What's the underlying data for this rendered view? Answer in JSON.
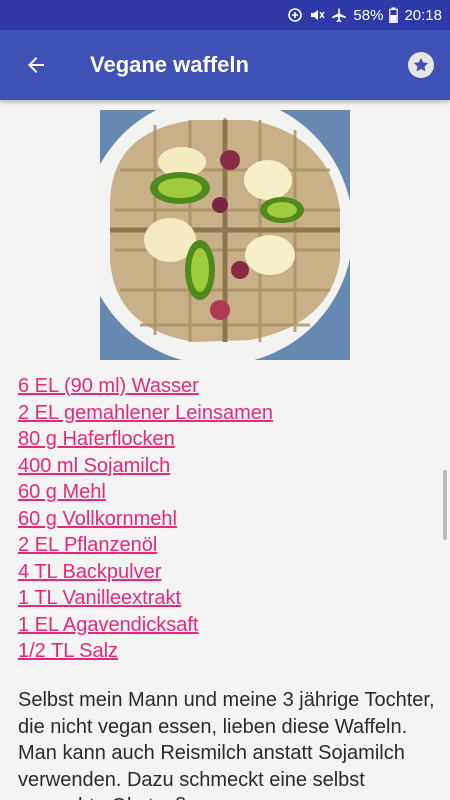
{
  "status_bar": {
    "battery": "58%",
    "time": "20:18",
    "icons": [
      "data-saver-icon",
      "mute-icon",
      "airplane-icon",
      "battery-icon"
    ]
  },
  "header": {
    "title": "Vegane waffeln",
    "back_icon": "arrow-back-icon",
    "favorite_icon": "star-icon",
    "color": "#3f51b5"
  },
  "recipe": {
    "image": "waffle-photo",
    "ingredients": [
      "6 EL (90 ml) Wasser",
      "2 EL gemahlener Leinsamen",
      "80 g Haferflocken",
      "400 ml Sojamilch",
      "60 g Mehl",
      "60 g Vollkornmehl",
      "2 EL Pflanzenöl",
      "4 TL Backpulver",
      "1 TL Vanilleextrakt",
      "1 EL Agavendicksaft",
      "1/2 TL Salz"
    ],
    "link_color": "#e8297a",
    "description": "Selbst mein Mann und meine 3 jährige Tochter, die nicht vegan essen, lieben diese Waffeln. Man kann auch Reismilch anstatt Sojamilch verwenden. Dazu schmeckt eine selbst gemachte Obstsoße"
  }
}
